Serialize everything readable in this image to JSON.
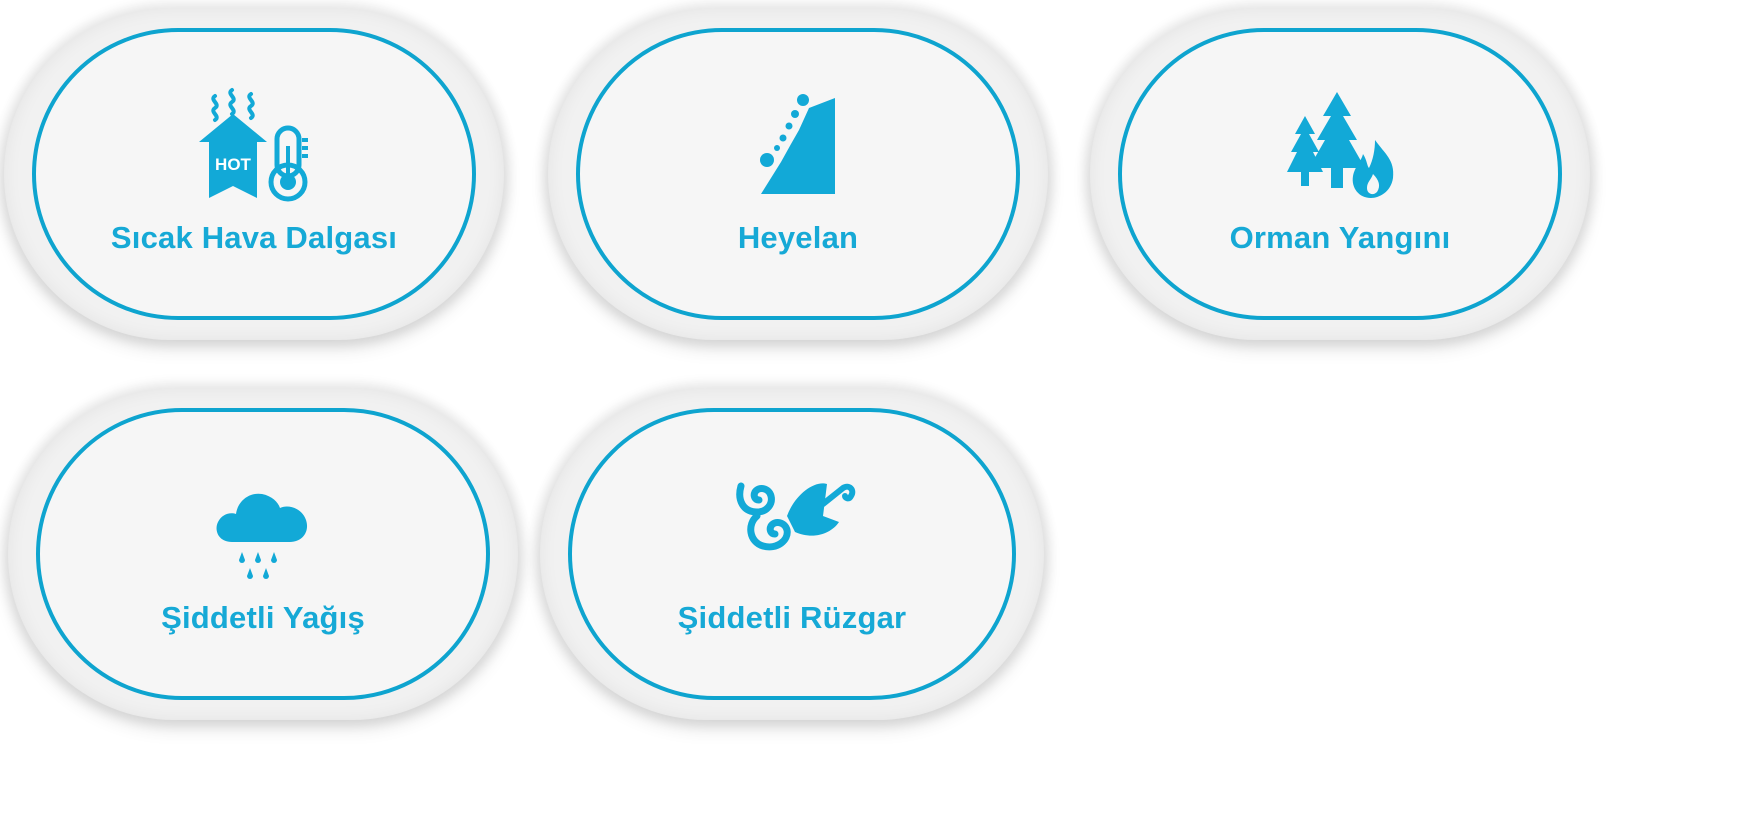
{
  "colors": {
    "accent": "#0ea4cf",
    "label": "#16a9d6",
    "card_background": "#f6f6f6"
  },
  "cards": [
    {
      "label": "Sıcak Hava Dalgası",
      "icon": "heatwave-icon",
      "icon_text": "HOT"
    },
    {
      "label": "Heyelan",
      "icon": "landslide-icon"
    },
    {
      "label": "Orman Yangını",
      "icon": "forest-fire-icon"
    },
    {
      "label": "Şiddetli Yağış",
      "icon": "heavy-rain-icon"
    },
    {
      "label": "Şiddetli Rüzgar",
      "icon": "strong-wind-icon"
    }
  ]
}
